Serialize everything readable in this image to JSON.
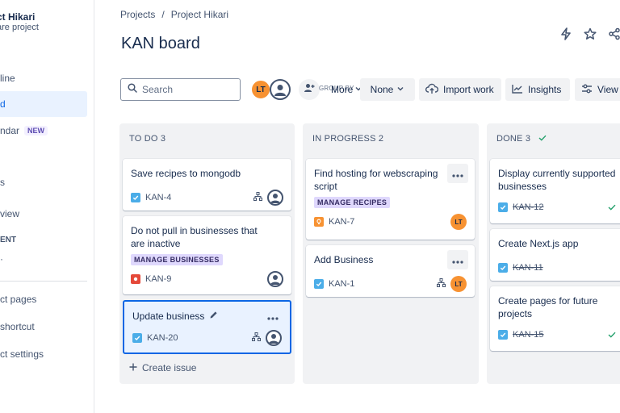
{
  "sidebar": {
    "project_name": "ct Hikari",
    "project_type": "are project",
    "items": [
      {
        "label": "line"
      },
      {
        "label": "d"
      },
      {
        "label": "ndar",
        "badge": "NEW"
      },
      {
        "label": "s"
      },
      {
        "label": "view"
      }
    ],
    "section_label": "ENT",
    "items2": [
      {
        "label": "ct pages"
      },
      {
        "label": "shortcut"
      },
      {
        "label": "ct settings"
      }
    ]
  },
  "header": {
    "breadcrumb": [
      "Projects",
      "/",
      "Project Hikari"
    ],
    "title": "KAN board"
  },
  "toolbar": {
    "search_placeholder": "Search",
    "avatar_initials": "LT",
    "group_by_label": "GROUP BY",
    "more_label": "More",
    "group_value": "None",
    "import_label": "Import work",
    "insights_label": "Insights",
    "view_label": "View"
  },
  "columns": [
    {
      "title": "TO DO 3",
      "cards": [
        {
          "title": "Save recipes to mongodb",
          "key": "KAN-4"
        },
        {
          "title": "Do not pull in businesses that are inactive",
          "epic": "MANAGE BUSINESSES",
          "key": "KAN-9"
        },
        {
          "title": "Update business",
          "key": "KAN-20"
        }
      ],
      "create_label": "Create issue"
    },
    {
      "title": "IN PROGRESS 2",
      "cards": [
        {
          "title": "Find hosting for webscraping script",
          "epic": "MANAGE RECIPES",
          "key": "KAN-7",
          "assignee": "LT"
        },
        {
          "title": "Add Business",
          "key": "KAN-1",
          "assignee": "LT"
        }
      ]
    },
    {
      "title": "DONE 3",
      "cards": [
        {
          "title": "Display currently supported businesses",
          "key": "KAN-12"
        },
        {
          "title": "Create Next.js app",
          "key": "KAN-11"
        },
        {
          "title": "Create pages for future projects",
          "key": "KAN-15"
        }
      ]
    }
  ],
  "colors": {
    "accent": "#0c66e4",
    "task_icon": "#4bade8",
    "bug_icon": "#e5493a",
    "story_icon": "#f79232",
    "avatar_orange": "#f79232",
    "done_check": "#22a06b",
    "epic_bg": "#dfd8fd"
  }
}
